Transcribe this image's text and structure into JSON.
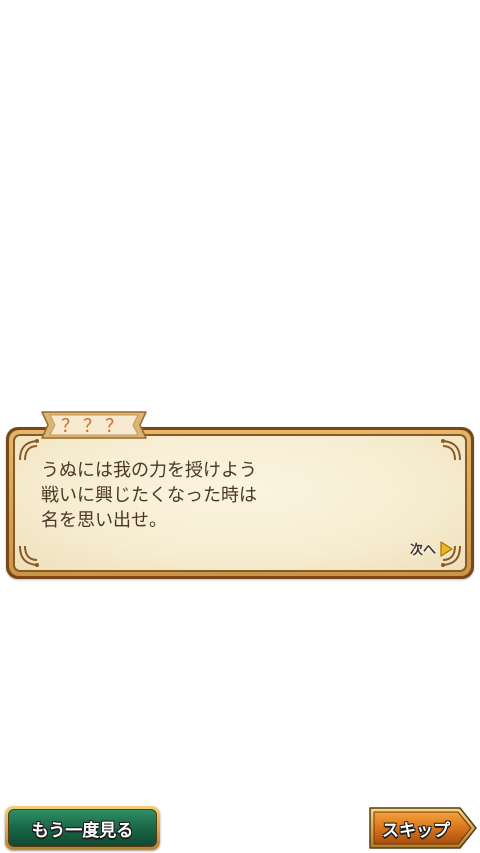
{
  "dialogue": {
    "speaker_name": "？？？",
    "lines": [
      "うぬには我の力を授けよう",
      "戦いに興じたくなった時は",
      "名を思い出せ。"
    ],
    "next_label": "次へ",
    "next_icon": "triangle-right-icon"
  },
  "controls": {
    "replay_label": "もう一度見る",
    "skip_label": "スキップ"
  },
  "colors": {
    "dialog_text": "#4a3728",
    "speaker_name": "#d26b28",
    "frame_dark": "#7a4818",
    "frame_gold": "#d4a45a",
    "panel_parchment": "#f6ecd0",
    "replay_button": "#1c6a49",
    "skip_button": "#d27820",
    "next_arrow": "#f0b820"
  }
}
